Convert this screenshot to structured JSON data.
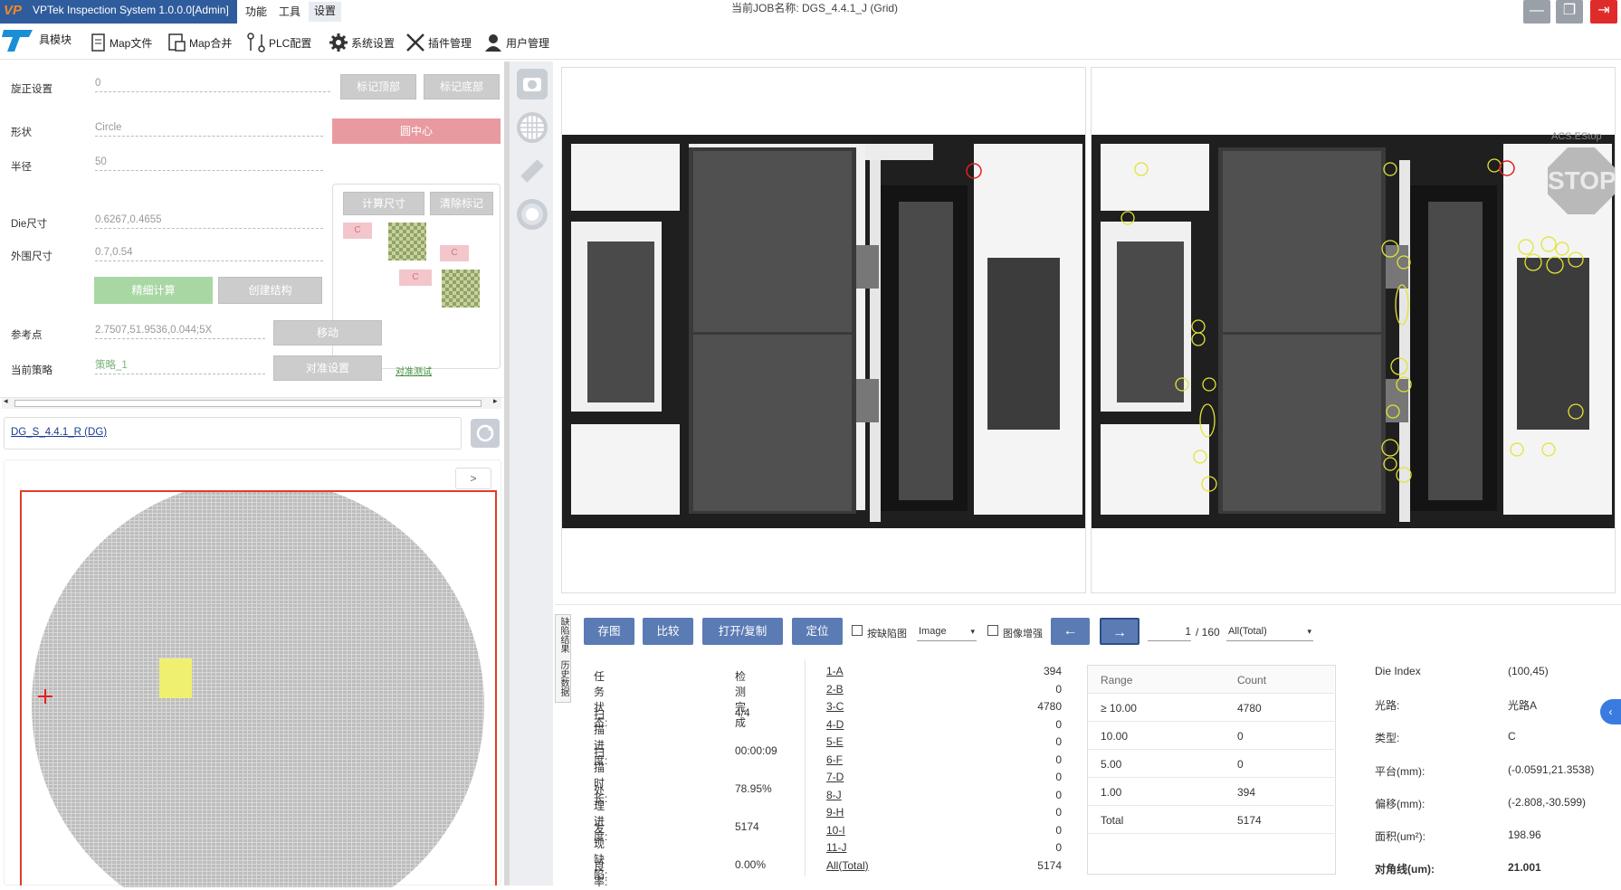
{
  "app": {
    "logo": "VP",
    "title": "VPTek Inspection System 1.0.0.0[Admin]",
    "menus": [
      "功能",
      "工具",
      "设置"
    ],
    "job_title": "当前JOB名称:  DGS_4.4.1_J (Grid)",
    "colors": {
      "title_bar": "#2f5c9c",
      "close": "#e02b2b",
      "accent": "#5b7bb4",
      "defect": "#e3e335"
    }
  },
  "toolbar": {
    "items": [
      "具模块",
      "Map文件",
      "Map合并",
      "PLC配置",
      "系统设置",
      "插件管理",
      "用户管理"
    ]
  },
  "align": {
    "rotate_label": "旋正设置",
    "rotate_value": "0",
    "mark_top": "标记顶部",
    "mark_bottom": "标记底部",
    "shape_label": "形状",
    "shape_value": "Circle",
    "center_btn": "圆中心",
    "radius_label": "半径",
    "radius_value": "50",
    "calc_size": "计算尺寸",
    "clear_mark": "清除标记",
    "die_label": "Die尺寸",
    "die_value": "0.6267,0.4655",
    "outer_label": "外围尺寸",
    "outer_value": "0.7,0.54",
    "fine_calc": "精细计算",
    "create_struct": "创建结构",
    "ref_label": "参考点",
    "ref_value": "2.7507,51.9536,0.044;5X",
    "move_btn": "移动",
    "strategy_label": "当前策略",
    "strategy_value": "策略_1",
    "align_btn": "对准设置",
    "align_test": "对准测试",
    "mark_c": "C"
  },
  "recipe": {
    "name": "DG_S_4.4.1_R (DG)",
    "expand": ">"
  },
  "viewer": {
    "estop_label": "ACS.EStop",
    "stop_text": "STOP"
  },
  "bottom": {
    "side_tabs": [
      "缺陷结果",
      "历史数据"
    ],
    "buttons": [
      "存图",
      "比较",
      "打开/复制",
      "定位"
    ],
    "show_defect_map": "按缺陷图",
    "image_select": "Image",
    "image_enhance": "图像增强",
    "prev": "←",
    "next": "→",
    "page_current": "1",
    "page_total": "/ 160",
    "filter": "All(Total)",
    "status": [
      {
        "label": "任务状态:",
        "value": "检测完成"
      },
      {
        "label": "扫描进度:",
        "value": "4/4"
      },
      {
        "label": "扫描时长:",
        "value": "00:00:09"
      },
      {
        "label": "处理进度:",
        "value": "78.95%"
      },
      {
        "label": "发现缺陷:",
        "value": "5174"
      },
      {
        "label": "良率:",
        "value": "0.00%"
      }
    ],
    "classes": [
      {
        "name": "1-A",
        "count": "394"
      },
      {
        "name": "2-B",
        "count": "0"
      },
      {
        "name": "3-C",
        "count": "4780"
      },
      {
        "name": "4-D",
        "count": "0"
      },
      {
        "name": "5-E",
        "count": "0"
      },
      {
        "name": "6-F",
        "count": "0"
      },
      {
        "name": "7-D",
        "count": "0"
      },
      {
        "name": "8-J",
        "count": "0"
      },
      {
        "name": "9-H",
        "count": "0"
      },
      {
        "name": "10-I",
        "count": "0"
      },
      {
        "name": "11-J",
        "count": "0"
      },
      {
        "name": "All(Total)",
        "count": "5174"
      }
    ],
    "range_header": {
      "range": "Range",
      "count": "Count"
    },
    "ranges": [
      {
        "range": "≥ 10.00",
        "count": "4780"
      },
      {
        "range": "10.00",
        "count": "0"
      },
      {
        "range": "5.00",
        "count": "0"
      },
      {
        "range": "1.00",
        "count": "394"
      },
      {
        "range": "Total",
        "count": "5174"
      }
    ],
    "details": [
      {
        "label": "Die Index",
        "value": "(100,45)"
      },
      {
        "label": "光路:",
        "value": "光路A"
      },
      {
        "label": "类型:",
        "value": "C"
      },
      {
        "label": "平台(mm):",
        "value": "(-0.0591,21.3538)"
      },
      {
        "label": "偏移(mm):",
        "value": "(-2.808,-30.599)"
      },
      {
        "label": "面积(um²):",
        "value": "198.96"
      },
      {
        "label": "对角线(um):",
        "value": "21.001"
      }
    ]
  }
}
